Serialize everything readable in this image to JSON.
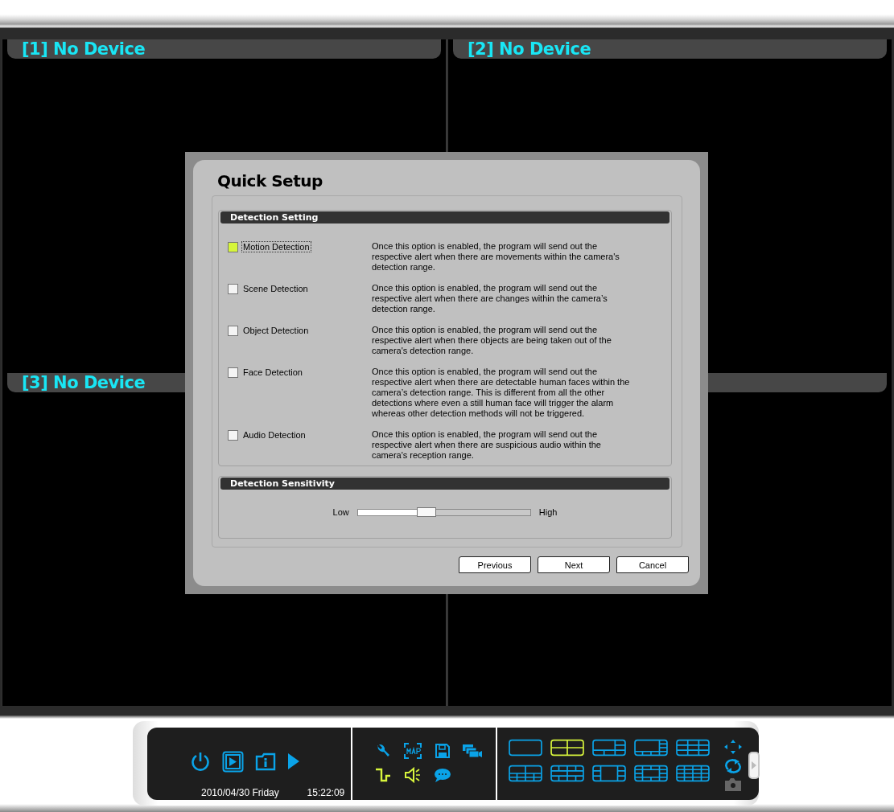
{
  "panes": [
    {
      "title": "[1] No Device"
    },
    {
      "title": "[2] No Device"
    },
    {
      "title": "[3] No Device"
    }
  ],
  "dialog": {
    "title": "Quick Setup",
    "detection_setting": {
      "header": "Detection Setting",
      "options": [
        {
          "label": "Motion Detection",
          "checked": true,
          "focused": true,
          "description": "Once this option is enabled, the program will send out the respective alert when there are movements within the camera's detection range."
        },
        {
          "label": "Scene Detection",
          "checked": false,
          "focused": false,
          "description": "Once this option is enabled, the program will send out the respective alert when there are changes within the camera’s detection range."
        },
        {
          "label": "Object Detection",
          "checked": false,
          "focused": false,
          "description": "Once this option is enabled, the program will send out the respective alert when there objects are being taken out of the camera's detection range."
        },
        {
          "label": "Face Detection",
          "checked": false,
          "focused": false,
          "description": "Once this option is enabled, the program will send out the respective alert when there are detectable human faces within the camera’s detection range. This is different from all the other detections where even a still human face will trigger the alarm whereas other detection methods will not be triggered."
        },
        {
          "label": "Audio Detection",
          "checked": false,
          "focused": false,
          "description": "Once this option is enabled, the program will send out the respective alert when there are suspicious audio within the camera's reception range."
        }
      ]
    },
    "detection_sensitivity": {
      "header": "Detection Sensitivity",
      "low_label": "Low",
      "high_label": "High",
      "level": 0.4
    },
    "buttons": [
      "Previous",
      "Next",
      "Cancel"
    ]
  },
  "toolbar": {
    "date": "2010/04/30 Friday",
    "time": "15:22:09",
    "main_buttons": [
      {
        "kind": "power"
      },
      {
        "kind": "playback"
      },
      {
        "kind": "info"
      },
      {
        "kind": "play"
      }
    ],
    "tools": [
      {
        "kind": "wrench",
        "on": false
      },
      {
        "kind": "map",
        "on": false
      },
      {
        "kind": "save",
        "on": false
      },
      {
        "kind": "cameras",
        "on": false
      },
      {
        "kind": "pulse",
        "on": true
      },
      {
        "kind": "speaker",
        "on": true
      },
      {
        "kind": "chat",
        "on": false
      }
    ],
    "layouts": [
      {
        "kind": "single",
        "selected": false
      },
      {
        "kind": "quad",
        "selected": true
      },
      {
        "kind": "six",
        "selected": false
      },
      {
        "kind": "eight",
        "selected": false
      },
      {
        "kind": "nine",
        "selected": false
      },
      {
        "kind": "ten",
        "selected": false
      },
      {
        "kind": "thirteen",
        "selected": false
      },
      {
        "kind": "side",
        "selected": false
      },
      {
        "kind": "ring",
        "selected": false
      },
      {
        "kind": "sixteen",
        "selected": false
      }
    ],
    "side_buttons": [
      {
        "kind": "ptz",
        "disabled": false
      },
      {
        "kind": "refresh",
        "disabled": false
      },
      {
        "kind": "snapshot",
        "disabled": true
      }
    ]
  }
}
